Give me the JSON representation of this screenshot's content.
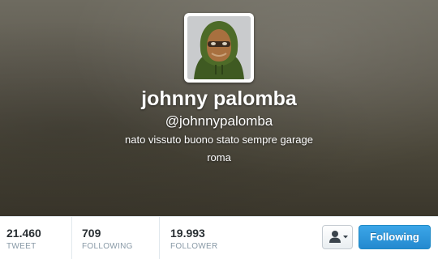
{
  "profile": {
    "name": "johnny palomba",
    "handle": "@johnnypalomba",
    "bio": "nato vissuto buono stato sempre garage",
    "location": "roma"
  },
  "stats": [
    {
      "value": "21.460",
      "label": "TWEET"
    },
    {
      "value": "709",
      "label": "FOLLOWING"
    },
    {
      "value": "19.993",
      "label": "FOLLOWER"
    }
  ],
  "actions": {
    "follow_label": "Following",
    "user_menu_icon": "person-icon"
  },
  "colors": {
    "accent": "#2b90d9",
    "header_dark": "#3a362b"
  }
}
